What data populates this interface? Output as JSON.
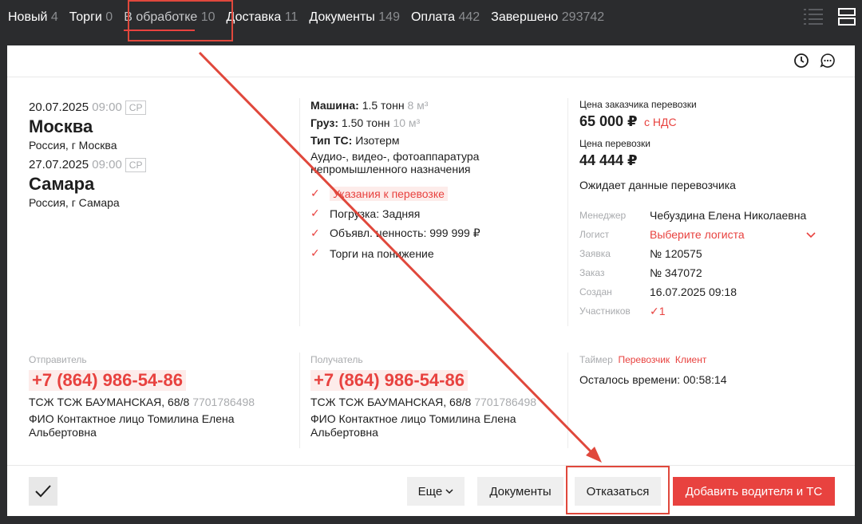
{
  "nav": {
    "tabs": [
      {
        "label": "Новый",
        "count": "4"
      },
      {
        "label": "Торги",
        "count": "0"
      },
      {
        "label": "В обработке",
        "count": "10"
      },
      {
        "label": "Доставка",
        "count": "11"
      },
      {
        "label": "Документы",
        "count": "149"
      },
      {
        "label": "Оплата",
        "count": "442"
      },
      {
        "label": "Завершено",
        "count": "293742"
      }
    ],
    "active_index": 2
  },
  "route": {
    "from": {
      "date": "20.07.2025",
      "time": "09:00",
      "badge": "СР",
      "city": "Москва",
      "address": "Россия, г Москва"
    },
    "to": {
      "date": "27.07.2025",
      "time": "09:00",
      "badge": "СР",
      "city": "Самара",
      "address": "Россия, г Самара"
    }
  },
  "cargo": {
    "machine_label": "Машина:",
    "machine_value": "1.5 тонн",
    "machine_volume": "8 м³",
    "cargo_label": "Груз:",
    "cargo_value": "1.50 тонн",
    "cargo_volume": "10 м³",
    "ts_label": "Тип ТС:",
    "ts_value": "Изотерм",
    "description": "Аудио-, видео-, фотоаппаратура непромышленного назначения",
    "checks": [
      "Указания к перевозке",
      "Погрузка: Задняя",
      "Объявл. ценность: 999 999 ₽",
      "Торги на понижение"
    ]
  },
  "pricing": {
    "customer_label": "Цена заказчика перевозки",
    "customer_price": "65 000 ₽",
    "vat": "с НДС",
    "price_label": "Цена перевозки",
    "price": "44 444 ₽",
    "status": "Ожидает данные перевозчика"
  },
  "details": {
    "manager_label": "Менеджер",
    "manager": "Чебуздина Елена Николаевна",
    "logist_label": "Логист",
    "logist": "Выберите логиста",
    "request_label": "Заявка",
    "request": "№ 120575",
    "order_label": "Заказ",
    "order": "№ 347072",
    "created_label": "Создан",
    "created": "16.07.2025 09:18",
    "participants_label": "Участников",
    "participants": "1"
  },
  "sender": {
    "label": "Отправитель",
    "phone": "+7 (864) 986-54-86",
    "org": "ТСЖ ТСЖ БАУМАНСКАЯ, 68/8",
    "inn": "7701786498",
    "contact": "ФИО Контактное лицо Томилина Елена Альбертовна"
  },
  "receiver": {
    "label": "Получатель",
    "phone": "+7 (864) 986-54-86",
    "org": "ТСЖ ТСЖ БАУМАНСКАЯ, 68/8",
    "inn": "7701786498",
    "contact": "ФИО Контактное лицо Томилина Елена Альбертовна"
  },
  "timer": {
    "label": "Таймер",
    "carrier": "Перевозчик",
    "client": "Клиент",
    "remaining": "Осталось времени: 00:58:14"
  },
  "actions": {
    "more": "Еще",
    "documents": "Документы",
    "refuse": "Отказаться",
    "add_driver": "Добавить водителя и ТС"
  },
  "colors": {
    "accent": "#e8423f",
    "nav_bg": "#2b2c2e",
    "annotation": "#e0483c"
  }
}
